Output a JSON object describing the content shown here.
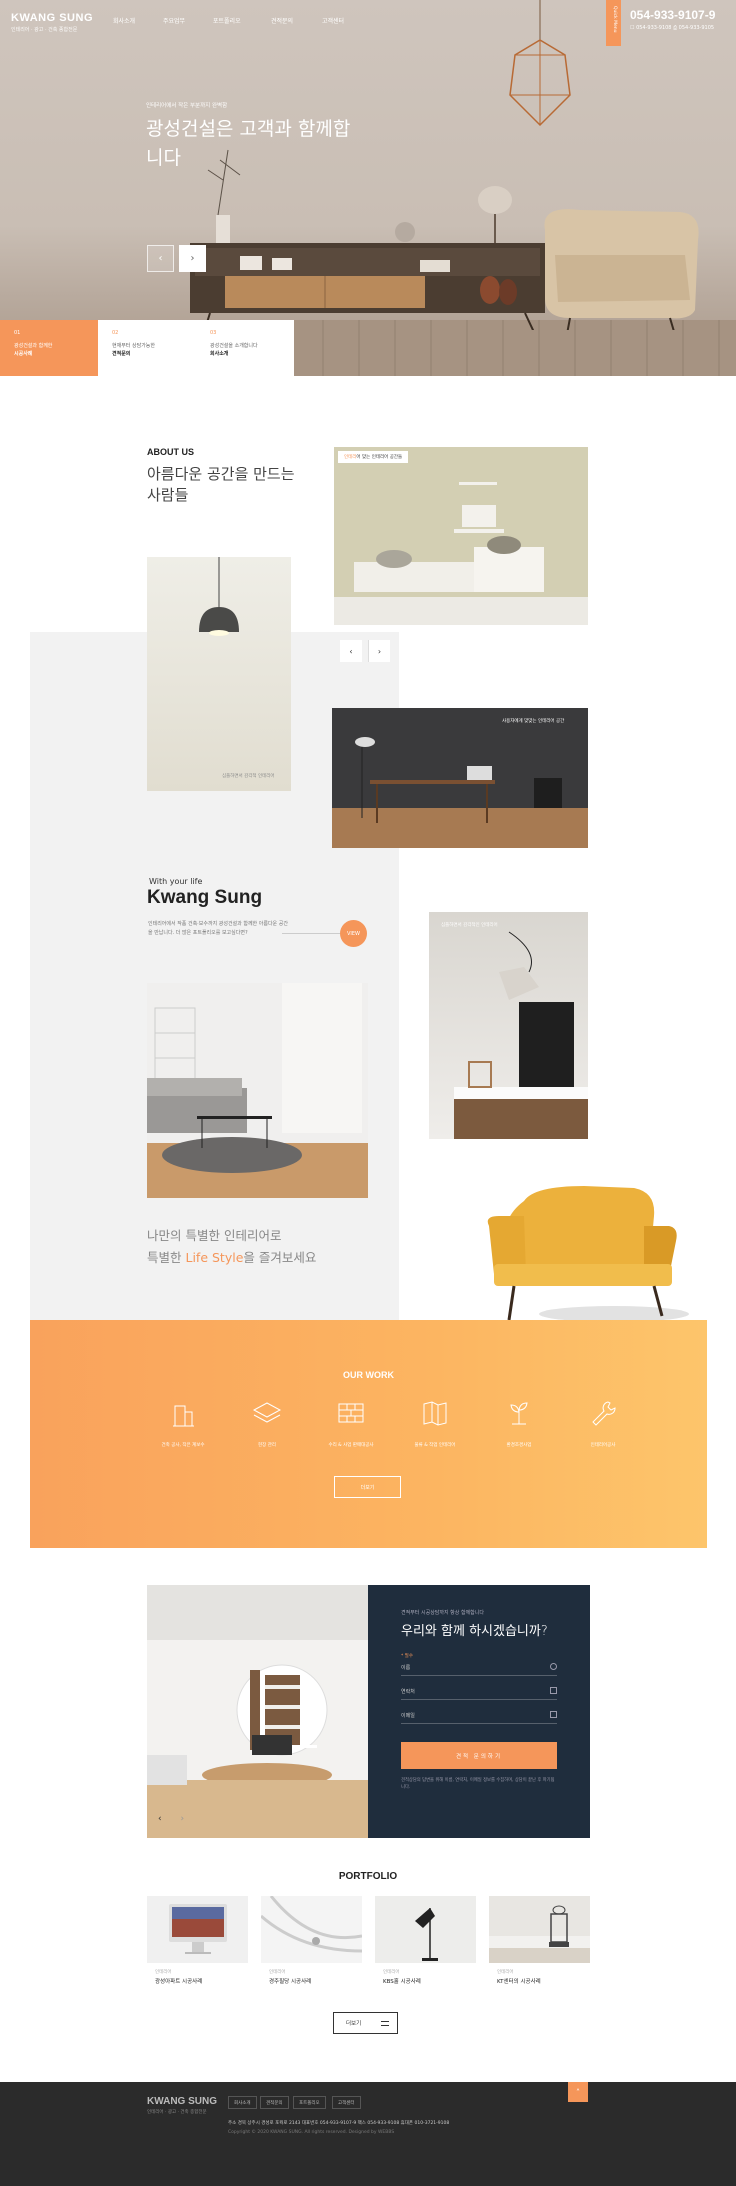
{
  "header": {
    "logo": "KWANG SUNG",
    "logo_sub": "인테리어 · 광고 · 건축 종합전문",
    "nav": [
      "회사소개",
      "주요업무",
      "포트폴리오",
      "견적문의",
      "고객센터"
    ],
    "side_tab": "Quick Menu",
    "phone": "054-933-9107-9",
    "phone_sub": "☐ 054-933-9108   ⎙ 054-933-9105"
  },
  "hero": {
    "kicker": "인테리어에서 작은 부분까지 완벽함",
    "title": "광성건설은 고객과 함께합니다",
    "prev": "‹",
    "next": "›"
  },
  "features": [
    {
      "num": "01",
      "desc": "광성건설과 함께한",
      "bold": "시공사례"
    },
    {
      "num": "02",
      "desc": "현재부터 상담가능한",
      "bold": "견적문의"
    },
    {
      "num": "03",
      "desc": "광성건설을 소개합니다",
      "bold": "회사소개"
    }
  ],
  "about": {
    "label": "ABOUT US",
    "title": "아름다운 공간을 만드는 사람들",
    "room_tag_hl": "인테리",
    "room_tag": "어 맞는 인테리어 공간들",
    "lamp_caption": "심플하면서 감각적 인테리어",
    "desk_caption": "사용자에게 맞맞는 인테리어 공간",
    "shelf_caption": "심플하면서 감각적인 인테리어",
    "slider": {
      "prev": "‹",
      "next": "›"
    }
  },
  "life": {
    "label": "With your life",
    "title": "Kwang Sung",
    "desc": "인테리어에서 작품 건축·보수까지 광성건설과 함께한 아름다운 공간을 만납니다. 더 많은 포트폴리오를 보고싶다면?",
    "more": "VIEW",
    "special_1": "나만의 특별한 인테리어로",
    "special_2a": "특별한 ",
    "special_hl": "Life Style",
    "special_2b": "을 즐겨보세요"
  },
  "work": {
    "title": "OUR WORK",
    "items": [
      "건축 공사, 작은 계보수",
      "현장 관리",
      "수리 & 사업 판매대공사",
      "물류 & 작업 인테리어",
      "환경조경사업",
      "인테리어공사"
    ],
    "button": "더보기"
  },
  "contact": {
    "kicker": "견적부터 시공상담까지 항상 함께합니다",
    "title": "우리와 함께 하시겠습니까?",
    "required": "* 필수",
    "fields": [
      "이름",
      "연락처",
      "이메일"
    ],
    "submit": "견적 문의하기",
    "agree": "견적상담의 답변을 위해 이름, 연락처, 이메일 정보를 수집하며, 상담이 끝난 후 파기됩니다.",
    "nav_prev": "‹",
    "nav_next": "›"
  },
  "portfolio": {
    "title": "PORTFOLIO",
    "items": [
      {
        "cat": "인테리어",
        "name": "광성아파트 시공사례"
      },
      {
        "cat": "인테리어",
        "name": "경주필당 시공사례"
      },
      {
        "cat": "인테리어",
        "name": "KBS홀 시공사례"
      },
      {
        "cat": "인테리어",
        "name": "KT센터의 시공사례"
      }
    ],
    "button": "더보기"
  },
  "footer": {
    "logo": "KWANG SUNG",
    "logo_sub": "인테리어 · 광고 · 건축 종합전문",
    "links": [
      "회사소개",
      "견적문의",
      "포트폴리오",
      "고객센터"
    ],
    "info": "주소 경북 상주시 경성로 포웍로 2143  대표번호 054-933-9107-9  팩스 054-933-9108  휴대폰 010-3721-9108",
    "copy": "Copyright © 2020 KWANG SUNG. All rights reserved. Designed by WEBBS",
    "top": "˄"
  },
  "colors": {
    "accent": "#f5965a",
    "navy": "#1f2d3d",
    "footer": "#2b2b2b"
  }
}
